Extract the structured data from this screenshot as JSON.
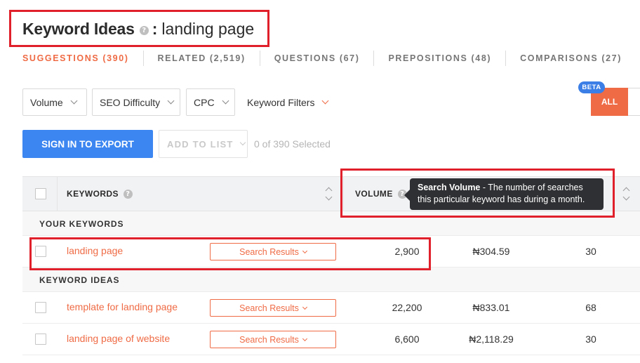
{
  "header": {
    "title": "Keyword Ideas",
    "help_glyph": "?",
    "separator": ":",
    "query": "landing page"
  },
  "tabs": [
    {
      "label": "SUGGESTIONS (390)",
      "active": true
    },
    {
      "label": "RELATED (2,519)",
      "active": false
    },
    {
      "label": "QUESTIONS (67)",
      "active": false
    },
    {
      "label": "PREPOSITIONS (48)",
      "active": false
    },
    {
      "label": "COMPARISONS (27)",
      "active": false
    }
  ],
  "filters": {
    "volume": "Volume",
    "seo_difficulty": "SEO Difficulty",
    "cpc": "CPC",
    "keyword_filters": "Keyword Filters",
    "beta_badge": "BETA",
    "all_button": "ALL"
  },
  "actions": {
    "export_label": "SIGN IN TO EXPORT",
    "add_to_list_label": "ADD TO LIST",
    "selected_count": "0 of 390 Selected"
  },
  "table": {
    "columns": {
      "keywords": "KEYWORDS",
      "volume": "VOLUME"
    },
    "sections": {
      "your_keywords": "YOUR KEYWORDS",
      "keyword_ideas": "KEYWORD IDEAS"
    },
    "serp_label": "Search Results",
    "your_keywords": [
      {
        "keyword": "landing page",
        "volume": "2,900",
        "cpc": "₦304.59",
        "metric": "30"
      }
    ],
    "keyword_ideas": [
      {
        "keyword": "template for landing page",
        "volume": "22,200",
        "cpc": "₦833.01",
        "metric": "68"
      },
      {
        "keyword": "landing page of website",
        "volume": "6,600",
        "cpc": "₦2,118.29",
        "metric": "30"
      }
    ]
  },
  "tooltip": {
    "title": "Search Volume",
    "body": " - The number of searches this particular keyword has during a month."
  },
  "colors": {
    "accent_orange": "#ef6b45",
    "primary_blue": "#3b86f0",
    "annotation_red": "#e0202a",
    "tooltip_bg": "#2f3033"
  }
}
